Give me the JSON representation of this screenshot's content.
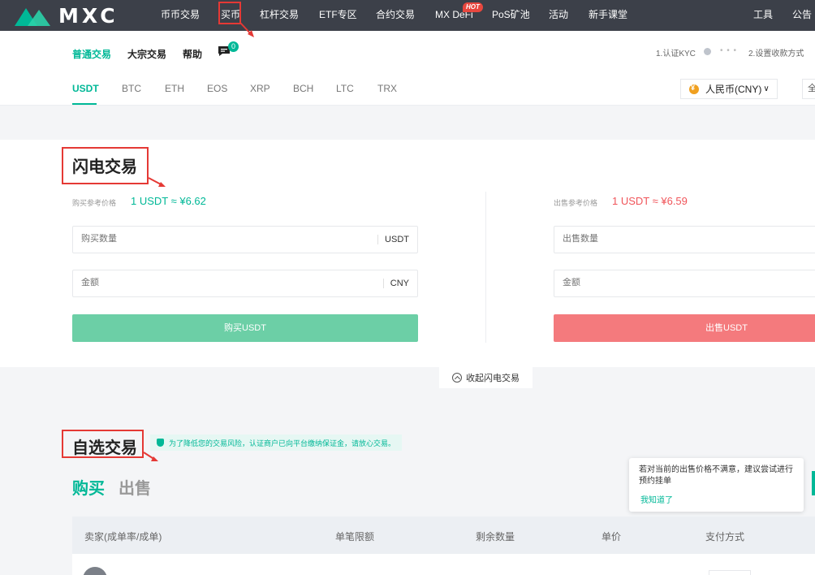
{
  "topnav": {
    "logo_text": "MXC",
    "items": [
      {
        "label": "币币交易"
      },
      {
        "label": "买币"
      },
      {
        "label": "杠杆交易"
      },
      {
        "label": "ETF专区"
      },
      {
        "label": "合约交易"
      },
      {
        "label": "MX DeFi"
      },
      {
        "label": "PoS矿池"
      },
      {
        "label": "活动"
      },
      {
        "label": "新手课堂"
      },
      {
        "label": "工具"
      },
      {
        "label": "公告"
      }
    ],
    "hot_badge": "HOT"
  },
  "subheader": {
    "tabs": [
      {
        "label": "普通交易"
      },
      {
        "label": "大宗交易"
      },
      {
        "label": "帮助"
      }
    ],
    "msg_count": "0",
    "step1": "1.认证KYC",
    "step_dots": "• • •",
    "step2": "2.设置收款方式",
    "coins": [
      "USDT",
      "BTC",
      "ETH",
      "EOS",
      "XRP",
      "BCH",
      "LTC",
      "TRX"
    ],
    "currency": "人民币(CNY)",
    "currency_caret": "∨",
    "right_box": "全"
  },
  "flash": {
    "title": "闪电交易",
    "buy_ref_label": "购买参考价格",
    "buy_ref_price": "1 USDT ≈ ¥6.62",
    "sell_ref_label": "出售参考价格",
    "sell_ref_price": "1 USDT ≈ ¥6.59",
    "buy_qty_placeholder": "购买数量",
    "buy_qty_unit": "USDT",
    "buy_amt_placeholder": "金额",
    "buy_amt_unit": "CNY",
    "buy_button": "购买USDT",
    "sell_qty_placeholder": "出售数量",
    "sell_amt_placeholder": "金额",
    "sell_button": "出售USDT",
    "collapse_label": "收起闪电交易"
  },
  "p2p": {
    "title": "自选交易",
    "notice": "为了降低您的交易风险，认证商户已向平台缴纳保证金，请放心交易。",
    "tab_buy": "购买",
    "tab_sell": "出售",
    "tooltip_text": "若对当前的出售价格不满意，建议尝试进行预约挂单",
    "tooltip_ok": "我知道了",
    "columns": [
      "卖家(成单率/成单)",
      "单笔限额",
      "剩余数量",
      "单价",
      "支付方式"
    ]
  },
  "colors": {
    "brand": "#00b897",
    "buy": "#6ccfa6",
    "sell": "#f47a7d",
    "annotation": "#e53935",
    "nav_bg": "#3c4049"
  }
}
